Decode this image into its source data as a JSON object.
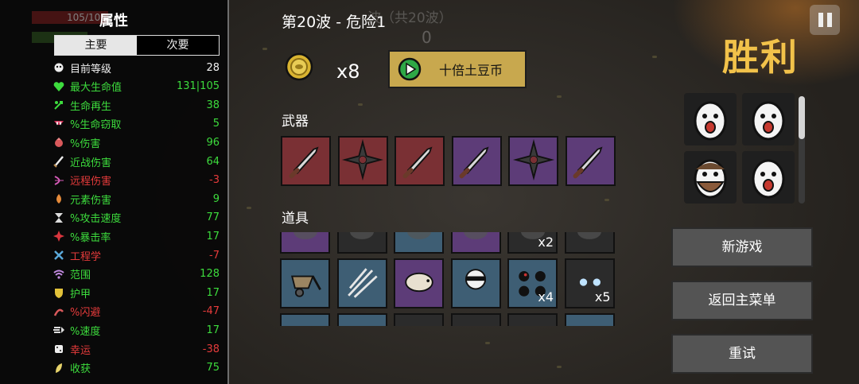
{
  "stats_panel": {
    "title": "属性",
    "hp_ghost": "105/105",
    "tabs": {
      "primary": "主要",
      "secondary": "次要"
    },
    "stats": [
      {
        "icon": "level-icon",
        "label": "目前等级",
        "value": "28",
        "color": "white"
      },
      {
        "icon": "heart-icon",
        "label": "最大生命值",
        "value": "131|105",
        "color": "green"
      },
      {
        "icon": "regen-icon",
        "label": "生命再生",
        "value": "38",
        "color": "green"
      },
      {
        "icon": "lifesteal-icon",
        "label": "%生命窃取",
        "value": "5",
        "color": "green"
      },
      {
        "icon": "damage-icon",
        "label": "%伤害",
        "value": "96",
        "color": "green"
      },
      {
        "icon": "melee-icon",
        "label": "近战伤害",
        "value": "64",
        "color": "green"
      },
      {
        "icon": "ranged-icon",
        "label": "远程伤害",
        "value": "-3",
        "color": "red"
      },
      {
        "icon": "elemental-icon",
        "label": "元素伤害",
        "value": "9",
        "color": "green"
      },
      {
        "icon": "attack-speed-icon",
        "label": "%攻击速度",
        "value": "77",
        "color": "green"
      },
      {
        "icon": "crit-icon",
        "label": "%暴击率",
        "value": "17",
        "color": "green"
      },
      {
        "icon": "engineering-icon",
        "label": "工程学",
        "value": "-7",
        "color": "red"
      },
      {
        "icon": "range-icon",
        "label": "范围",
        "value": "128",
        "color": "green"
      },
      {
        "icon": "armor-icon",
        "label": "护甲",
        "value": "17",
        "color": "green"
      },
      {
        "icon": "dodge-icon",
        "label": "%闪避",
        "value": "-47",
        "color": "red"
      },
      {
        "icon": "speed-icon",
        "label": "%速度",
        "value": "17",
        "color": "green"
      },
      {
        "icon": "luck-icon",
        "label": "幸运",
        "value": "-38",
        "color": "red"
      },
      {
        "icon": "harvest-icon",
        "label": "收获",
        "value": "75",
        "color": "green"
      }
    ]
  },
  "header": {
    "wave_title": "第20波 - 危险1",
    "wave_ghost": "波（共20波）",
    "kill_ghost": "0"
  },
  "currency": {
    "icon": "potato-coin-icon",
    "count": "x8"
  },
  "boost_button": {
    "label": "十倍土豆币",
    "icon": "play-icon"
  },
  "weapons": {
    "label": "武器",
    "slots": [
      {
        "tier": "red",
        "icon": "knife-icon"
      },
      {
        "tier": "red",
        "icon": "shuriken-icon"
      },
      {
        "tier": "red",
        "icon": "knife-icon"
      },
      {
        "tier": "purple",
        "icon": "knife-icon"
      },
      {
        "tier": "purple",
        "icon": "shuriken-icon"
      },
      {
        "tier": "purple",
        "icon": "knife-icon"
      }
    ]
  },
  "items": {
    "label": "道具",
    "row_partial_top": [
      {
        "tier": "purple",
        "icon": "item-icon",
        "qty": ""
      },
      {
        "tier": "dark",
        "icon": "item-icon",
        "qty": ""
      },
      {
        "tier": "blue",
        "icon": "item-icon",
        "qty": ""
      },
      {
        "tier": "purple",
        "icon": "item-icon",
        "qty": ""
      },
      {
        "tier": "dark",
        "icon": "item-icon",
        "qty": "x2"
      },
      {
        "tier": "dark",
        "icon": "item-icon",
        "qty": ""
      }
    ],
    "row_full": [
      {
        "tier": "blue",
        "icon": "wheelbarrow-icon",
        "qty": ""
      },
      {
        "tier": "blue",
        "icon": "claw-icon",
        "qty": ""
      },
      {
        "tier": "purple",
        "icon": "tardigrade-icon",
        "qty": ""
      },
      {
        "tier": "blue",
        "icon": "ninja-icon",
        "qty": ""
      },
      {
        "tier": "blue",
        "icon": "bombs-icon",
        "qty": "x4"
      },
      {
        "tier": "dark",
        "icon": "ghost-icon",
        "qty": "x5"
      }
    ]
  },
  "victory_title": "胜利",
  "characters": [
    {
      "icon": "egg-character-icon"
    },
    {
      "icon": "egg-character-icon"
    },
    {
      "icon": "bearded-character-icon"
    },
    {
      "icon": "egg-character-icon"
    }
  ],
  "menu": {
    "new_game": "新游戏",
    "main_menu": "返回主菜单",
    "retry": "重试"
  },
  "colors": {
    "victory": "#f2c24a",
    "boost_button": "#c8a84e",
    "tier_red": "#7a3034",
    "tier_blue": "#3e5e74",
    "tier_purple": "#5d3c78",
    "stat_green": "#3ddc3d",
    "stat_red": "#e63b3b"
  }
}
